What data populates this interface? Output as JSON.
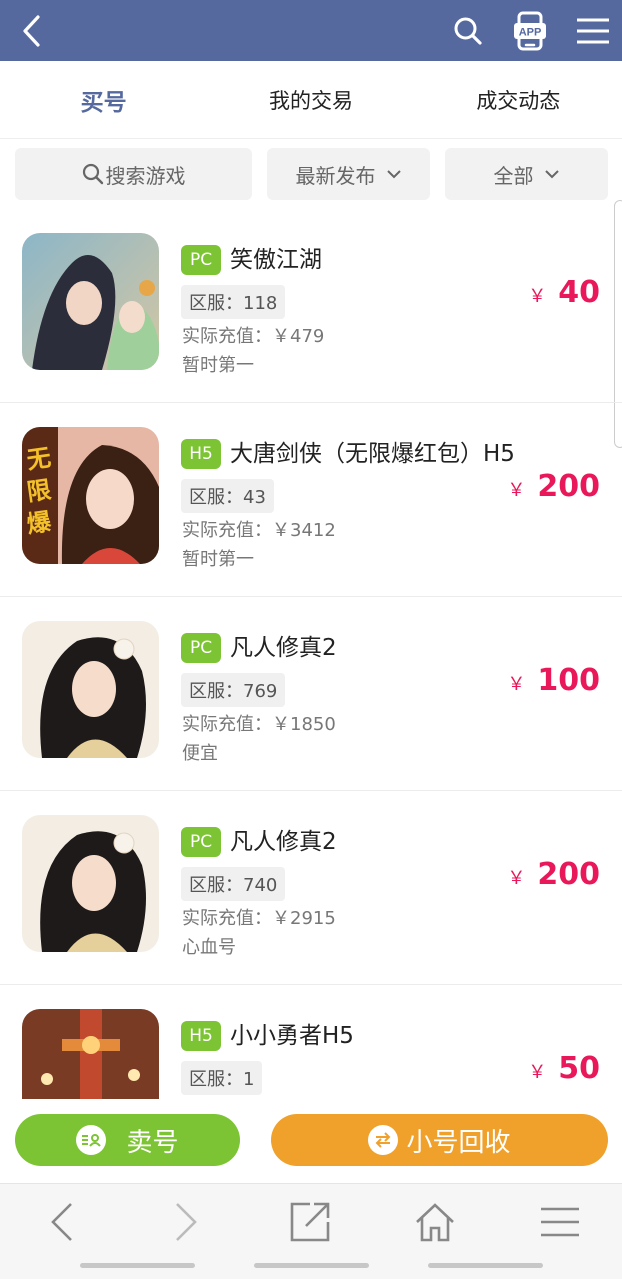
{
  "header": {
    "back_icon": "chevron-left-icon",
    "search_icon": "search-icon",
    "app_badge": "APP",
    "menu_icon": "hamburger-icon",
    "background": "#55699f"
  },
  "tabs": [
    {
      "label": "买号",
      "active": true
    },
    {
      "label": "我的交易",
      "active": false
    },
    {
      "label": "成交动态",
      "active": false
    }
  ],
  "filters": {
    "search_placeholder": "搜索游戏",
    "sort_label": "最新发布",
    "category_label": "全部"
  },
  "currency": "￥",
  "listings": [
    {
      "platform": "PC",
      "title": "笑傲江湖",
      "server": "区服：118",
      "recharge": "实际充值：￥479",
      "note": "暂时第一",
      "price": "40"
    },
    {
      "platform": "H5",
      "title": "大唐剑侠（无限爆红包）H5",
      "server": "区服：43",
      "recharge": "实际充值：￥3412",
      "note": "暂时第一",
      "price": "200"
    },
    {
      "platform": "PC",
      "title": "凡人修真2",
      "server": "区服：769",
      "recharge": "实际充值：￥1850",
      "note": "便宜",
      "price": "100"
    },
    {
      "platform": "PC",
      "title": "凡人修真2",
      "server": "区服：740",
      "recharge": "实际充值：￥2915",
      "note": "心血号",
      "price": "200"
    },
    {
      "platform": "H5",
      "title": "小小勇者H5",
      "server": "区服：1",
      "recharge": "",
      "note": "",
      "price": "50"
    }
  ],
  "actions": {
    "sell_label": "卖号",
    "recycle_label": "小号回收",
    "sell_color": "#7cc433",
    "recycle_color": "#f0a12b"
  },
  "colors": {
    "price": "#e8185a",
    "tag": "#7cc433",
    "accent": "#55699f"
  },
  "browser_bar": [
    "back-icon",
    "forward-icon",
    "share-icon",
    "home-icon",
    "menu-icon"
  ]
}
